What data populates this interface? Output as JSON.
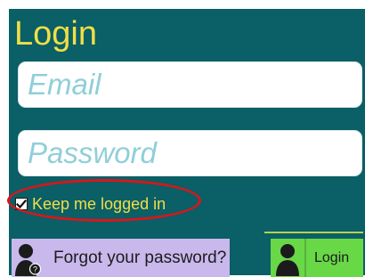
{
  "login": {
    "title": "Login",
    "email": {
      "placeholder": "Email",
      "value": ""
    },
    "password": {
      "placeholder": "Password",
      "value": ""
    },
    "remember": {
      "label": "Keep me logged in",
      "checked": true
    },
    "forgot_password": {
      "label": "Forgot your password?",
      "icon": "user-help-icon"
    },
    "submit": {
      "label": "Login",
      "icon": "user-icon"
    },
    "colors": {
      "panel_bg": "#0b5f66",
      "title": "#f2df46",
      "placeholder": "#8fcfd8",
      "highlight_ring": "#d8161a",
      "forgot_button_bg": "#c9b8ec",
      "login_button_bg": "#69d847"
    }
  }
}
